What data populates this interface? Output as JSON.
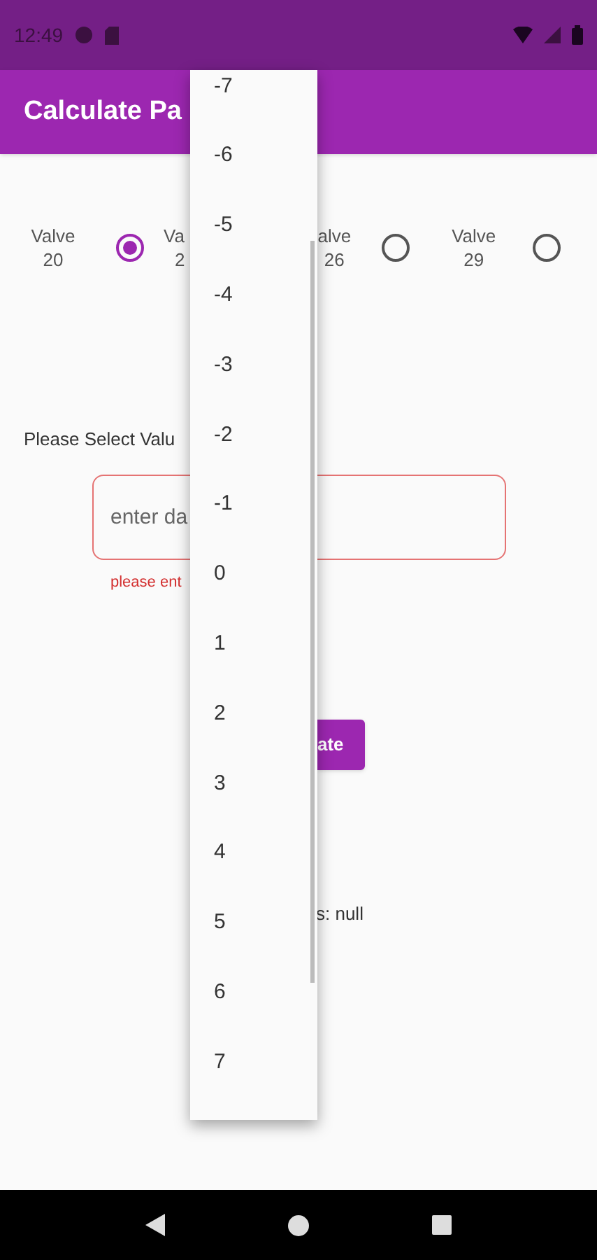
{
  "status_bar": {
    "time": "12:49"
  },
  "app_bar": {
    "title": "Calculate Pa"
  },
  "valves": [
    {
      "label": "Valve",
      "number": "20",
      "selected": true
    },
    {
      "label": "Va",
      "number": "2"
    },
    {
      "label": "alve",
      "number": "26",
      "selected": false
    },
    {
      "label": "Valve",
      "number": "29",
      "selected": false
    }
  ],
  "prompt": "Please Select Valu",
  "field": {
    "placeholder": "enter da",
    "error": "please ent"
  },
  "button": "ate",
  "result": "s: null",
  "menu": {
    "items": [
      "-7",
      "-6",
      "-5",
      "-4",
      "-3",
      "-2",
      "-1",
      "0",
      "1",
      "2",
      "3",
      "4",
      "5",
      "6",
      "7"
    ]
  }
}
